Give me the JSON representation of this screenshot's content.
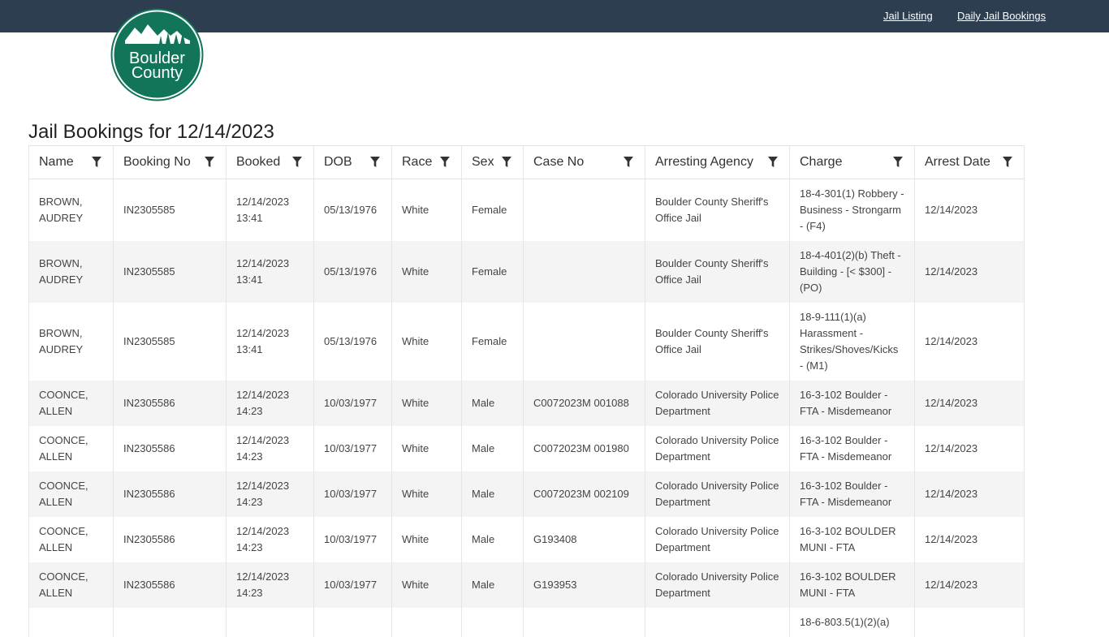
{
  "nav": {
    "jail_listing": "Jail Listing",
    "daily_bookings": "Daily Jail Bookings"
  },
  "logo": {
    "line1": "Boulder",
    "line2": "County"
  },
  "page": {
    "title": "Jail Bookings for 12/14/2023"
  },
  "colors": {
    "topbar": "#2c3e4f",
    "logo_green": "#12755a"
  },
  "table": {
    "columns": [
      "Name",
      "Booking No",
      "Booked",
      "DOB",
      "Race",
      "Sex",
      "Case No",
      "Arresting Agency",
      "Charge",
      "Arrest Date"
    ],
    "rows": [
      {
        "name": "BROWN, AUDREY",
        "booking_no": "IN2305585",
        "booked": "12/14/2023 13:41",
        "dob": "05/13/1976",
        "race": "White",
        "sex": "Female",
        "case_no": "",
        "agency": "Boulder County Sheriff's Office Jail",
        "charge": "18-4-301(1) Robbery - Business - Strongarm - (F4)",
        "arrest_date": "12/14/2023"
      },
      {
        "name": "BROWN, AUDREY",
        "booking_no": "IN2305585",
        "booked": "12/14/2023 13:41",
        "dob": "05/13/1976",
        "race": "White",
        "sex": "Female",
        "case_no": "",
        "agency": "Boulder County Sheriff's Office Jail",
        "charge": "18-4-401(2)(b) Theft - Building - [< $300] - (PO)",
        "arrest_date": "12/14/2023"
      },
      {
        "name": "BROWN, AUDREY",
        "booking_no": "IN2305585",
        "booked": "12/14/2023 13:41",
        "dob": "05/13/1976",
        "race": "White",
        "sex": "Female",
        "case_no": "",
        "agency": "Boulder County Sheriff's Office Jail",
        "charge": "18-9-111(1)(a) Harassment - Strikes/Shoves/Kicks - (M1)",
        "arrest_date": "12/14/2023"
      },
      {
        "name": "COONCE, ALLEN",
        "booking_no": "IN2305586",
        "booked": "12/14/2023 14:23",
        "dob": "10/03/1977",
        "race": "White",
        "sex": "Male",
        "case_no": "C0072023M 001088",
        "agency": "Colorado University Police Department",
        "charge": "16-3-102 Boulder - FTA - Misdemeanor",
        "arrest_date": "12/14/2023"
      },
      {
        "name": "COONCE, ALLEN",
        "booking_no": "IN2305586",
        "booked": "12/14/2023 14:23",
        "dob": "10/03/1977",
        "race": "White",
        "sex": "Male",
        "case_no": "C0072023M 001980",
        "agency": "Colorado University Police Department",
        "charge": "16-3-102 Boulder - FTA - Misdemeanor",
        "arrest_date": "12/14/2023"
      },
      {
        "name": "COONCE, ALLEN",
        "booking_no": "IN2305586",
        "booked": "12/14/2023 14:23",
        "dob": "10/03/1977",
        "race": "White",
        "sex": "Male",
        "case_no": "C0072023M 002109",
        "agency": "Colorado University Police Department",
        "charge": "16-3-102 Boulder - FTA - Misdemeanor",
        "arrest_date": "12/14/2023"
      },
      {
        "name": "COONCE, ALLEN",
        "booking_no": "IN2305586",
        "booked": "12/14/2023 14:23",
        "dob": "10/03/1977",
        "race": "White",
        "sex": "Male",
        "case_no": "G193408",
        "agency": "Colorado University Police Department",
        "charge": "16-3-102 BOULDER MUNI - FTA",
        "arrest_date": "12/14/2023"
      },
      {
        "name": "COONCE, ALLEN",
        "booking_no": "IN2305586",
        "booked": "12/14/2023 14:23",
        "dob": "10/03/1977",
        "race": "White",
        "sex": "Male",
        "case_no": "G193953",
        "agency": "Colorado University Police Department",
        "charge": "16-3-102 BOULDER MUNI - FTA",
        "arrest_date": "12/14/2023"
      },
      {
        "name": "",
        "booking_no": "",
        "booked": "",
        "dob": "",
        "race": "",
        "sex": "",
        "case_no": "",
        "agency": "",
        "charge": "18-6-803.5(1)(2)(a)",
        "arrest_date": ""
      }
    ]
  }
}
